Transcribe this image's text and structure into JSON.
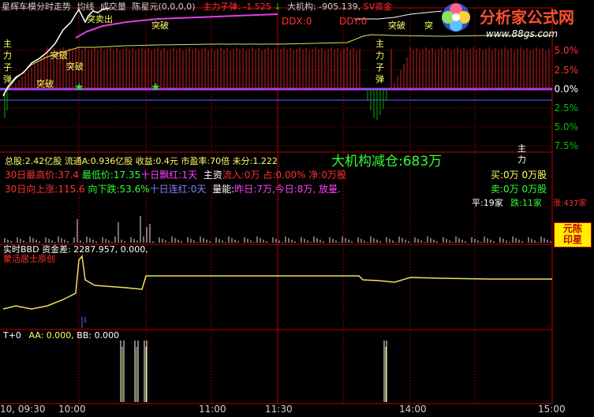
{
  "header": {
    "title": "星辉车模分时走势",
    "menu": [
      "均线",
      "成交量",
      "陈星元(0,0,0,0)"
    ],
    "zl_label": "主力子弹:",
    "zl_value": "-1.525",
    "arrow": "↓",
    "jg_label": "大机构:",
    "jg_value": "-905.139,",
    "sv_label": "SV资金",
    "ddx": "DDX:0",
    "ddy": "DDY:0"
  },
  "logo": {
    "brand": "分析家公式网",
    "url": "www.88gs.com"
  },
  "price_axis": {
    "up": [
      "5.0%",
      "2.5%",
      "0.0%"
    ],
    "down": [
      "2.5%",
      "5.0%",
      "7.5%"
    ]
  },
  "chart_labels": {
    "tuxing": "突破",
    "tuxing2": "突破",
    "tuxing3": "突破",
    "tuxing4": "突破",
    "tuxing5": "突",
    "tuxing6": "突破",
    "tmai": "突卖出",
    "zlzd": [
      "主",
      "力",
      "子",
      "弹"
    ],
    "zlzd2": [
      "主",
      "力",
      "子",
      "弹"
    ]
  },
  "info": {
    "line1": "总股:2.42亿股 流通A:0.936亿股 收益:0.4元 市盈率:70倍 未分:1.222",
    "big_reduce": "大机构减仓:683万",
    "zl_vertical": [
      "主",
      "力"
    ],
    "high_label": "30日最高价:37.4",
    "low_label": "最低价:17.35",
    "ten_red": "十日飘红:1天",
    "zj_label": "主资",
    "zj_flow": "流入:0万",
    "zj_ratio": "占:0.00%",
    "zj_net": "净:0万股",
    "buy": "买:0万 0万股",
    "rise_label": "30日向上涨:115.6",
    "down_label": "向下跌:53.6%",
    "ten_lian": "十日连红:0天",
    "liangneng": "量能:",
    "vol_text": "昨日:7万,今日:8万, 放量.",
    "sell": "卖:0万 0万股",
    "flat": "平:19家",
    "fall": "跌:11家",
    "rise_count": "涨:437家"
  },
  "seal": {
    "line1": "元陈",
    "line2": "印星"
  },
  "bbd_panel": {
    "title": "实时BBD",
    "zjc": "资金差: 2287.957, 0.000,",
    "author": "蒙活居士原创"
  },
  "t0_panel": {
    "title": "T+0",
    "aa": "AA: 0.000,",
    "bb": "BB: 0.000"
  },
  "time_axis": [
    "10, 09:30",
    "10:00",
    "11:00",
    "11:30",
    "14:00",
    "15:00"
  ]
}
